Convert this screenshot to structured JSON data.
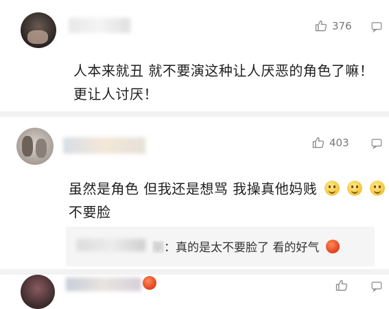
{
  "comments": [
    {
      "likes": "376",
      "lines": [
        "人本来就丑 就不要演这种让人厌恶的角色了嘛！",
        "更让人讨厌！"
      ]
    },
    {
      "likes": "403",
      "line1": "虽然是角色 但我还是想骂 我操真他妈贱",
      "line2": "不要脸",
      "reply_name_tail": "丽",
      "reply_text": "：真的是太不要脸了 看的好气"
    }
  ],
  "icons": {
    "like": "thumbs-up-icon",
    "reply": "reply-icon",
    "emoji_smile": "smiling-face-emoji",
    "emoji_angry": "angry-face-emoji"
  }
}
